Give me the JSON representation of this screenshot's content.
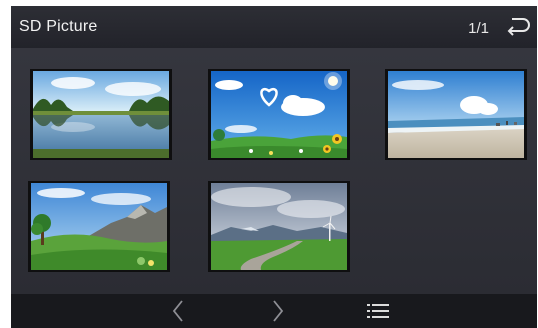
{
  "header": {
    "title": "SD Picture",
    "page_indicator": "1/1",
    "back_icon": "return-arrow-icon"
  },
  "gallery": {
    "items": [
      {
        "name": "lake-reflection",
        "icon": "image-thumbnail"
      },
      {
        "name": "heart-cloud-sky",
        "icon": "image-thumbnail"
      },
      {
        "name": "beach-shore",
        "icon": "image-thumbnail"
      },
      {
        "name": "green-hills-mountains",
        "icon": "image-thumbnail"
      },
      {
        "name": "road-in-field",
        "icon": "image-thumbnail"
      }
    ]
  },
  "toolbar": {
    "prev_icon": "chevron-left-icon",
    "next_icon": "chevron-right-icon",
    "list_icon": "list-menu-icon"
  },
  "colors": {
    "background": "#26272d",
    "header": "#2d2e35",
    "bottom_bar": "#18191d",
    "text": "#f2f2f2"
  }
}
